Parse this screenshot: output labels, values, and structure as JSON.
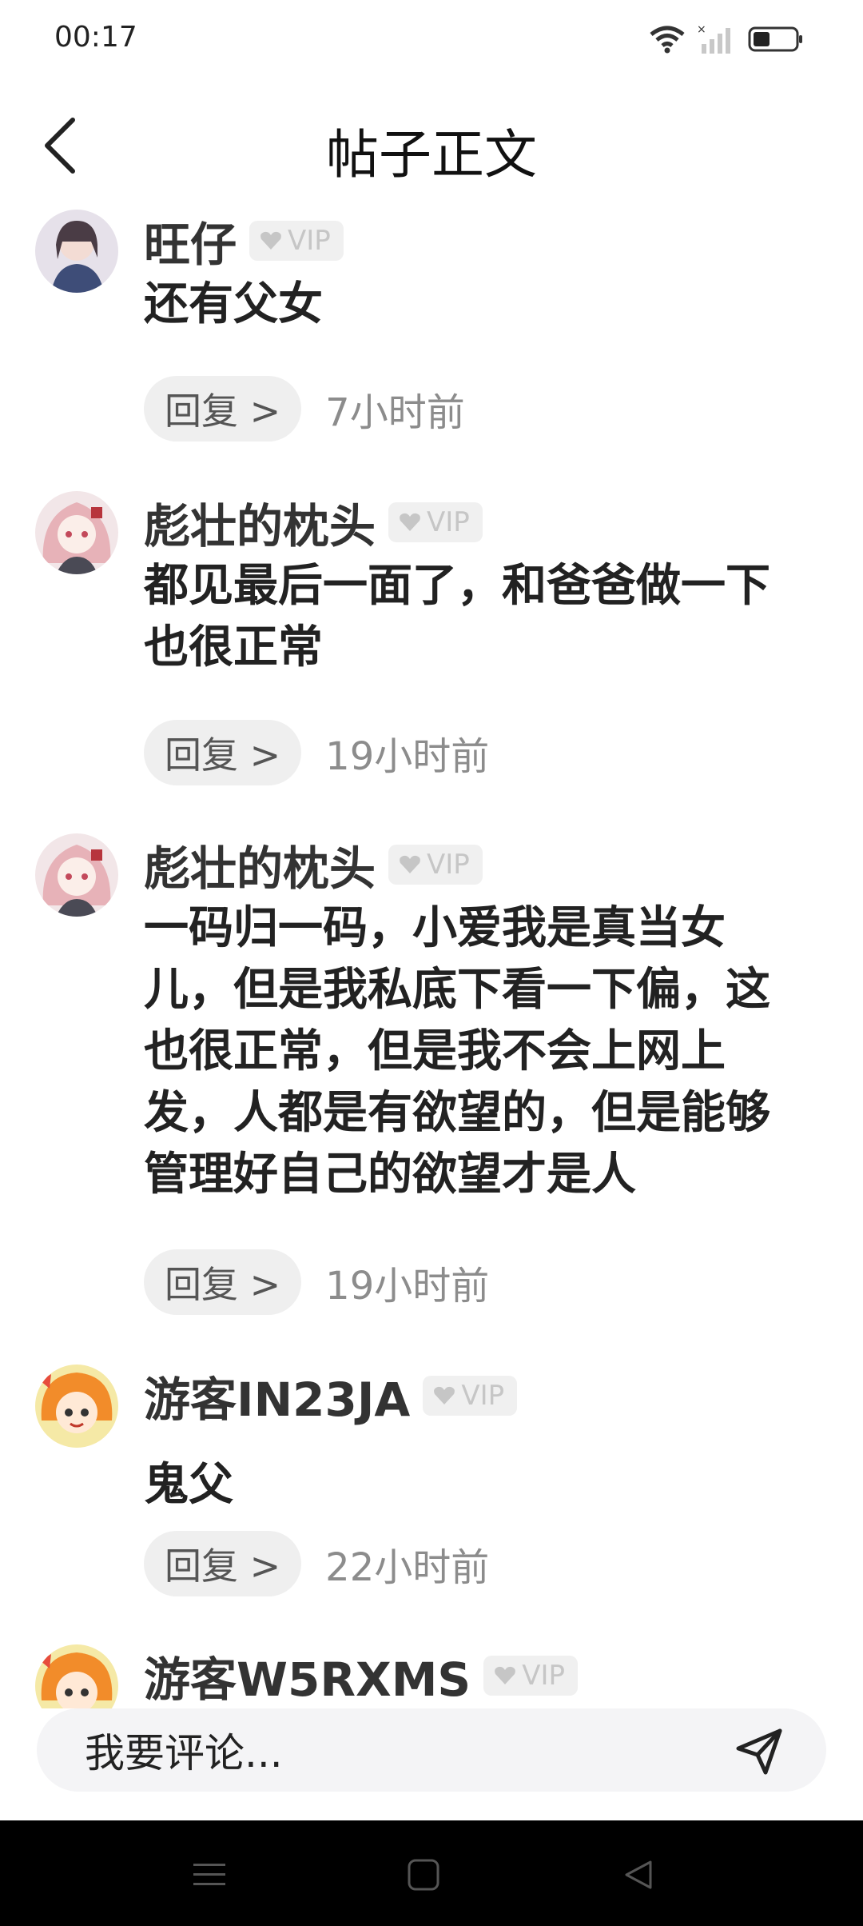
{
  "status_bar": {
    "time": "00:17"
  },
  "header": {
    "title": "帖子正文"
  },
  "comments": [
    {
      "user": "旺仔",
      "badge": "VIP",
      "text": "还有父女",
      "reply_label": "回复 >",
      "time": "7小时前",
      "avatar_color": "#6b5d73"
    },
    {
      "user": "彪壮的枕头",
      "badge": "VIP",
      "text": "都见最后一面了，和爸爸做一下\n也很正常",
      "reply_label": "回复 >",
      "time": "19小时前",
      "avatar_color": "#e8c0c4"
    },
    {
      "user": "彪壮的枕头",
      "badge": "VIP",
      "text": "一码归一码，小爱我是真当女\n儿，但是我私底下看一下偏，这\n也很正常，但是我不会上网上\n发，人都是有欲望的，但是能够\n管理好自己的欲望才是人",
      "reply_label": "回复 >",
      "time": "19小时前",
      "avatar_color": "#e8c0c4"
    },
    {
      "user": "游客IN23JA",
      "badge": "VIP",
      "text": "鬼父",
      "reply_label": "回复 >",
      "time": "22小时前",
      "avatar_color": "#f2d23a"
    },
    {
      "user": "游客W5RXMS",
      "badge": "VIP",
      "avatar_color": "#f2d23a"
    }
  ],
  "comment_input": {
    "placeholder": "我要评论..."
  }
}
